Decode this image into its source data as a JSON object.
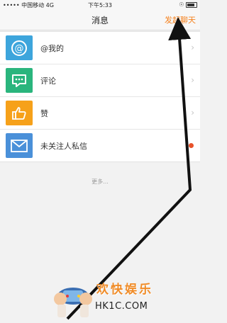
{
  "status_bar": {
    "carrier": "••••• 中国移动  4G",
    "time": "下午5:33",
    "right": "☉"
  },
  "nav": {
    "title": "消息",
    "action": "发起聊天"
  },
  "list": {
    "items": [
      {
        "label": "@我的",
        "icon": "at-icon",
        "color": "#3da5dc"
      },
      {
        "label": "评论",
        "icon": "comment-icon",
        "color": "#2ab57d"
      },
      {
        "label": "赞",
        "icon": "thumbs-up-icon",
        "color": "#f6a11a"
      },
      {
        "label": "未关注人私信",
        "icon": "envelope-icon",
        "color": "#4a90d9"
      }
    ],
    "chevron": "›",
    "unread_color": "#e8522a"
  },
  "more": "更多...",
  "watermark": {
    "cn": "欢快娱乐",
    "en": "HK1C.COM"
  },
  "arrow_color": "#111111"
}
